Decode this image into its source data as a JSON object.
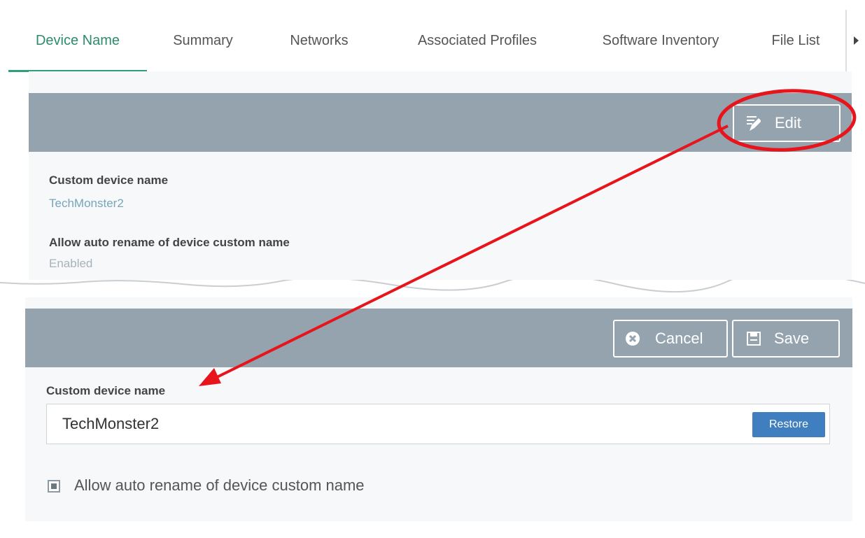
{
  "tabs": [
    {
      "label": "Device Name",
      "active": true
    },
    {
      "label": "Summary",
      "active": false
    },
    {
      "label": "Networks",
      "active": false
    },
    {
      "label": "Associated Profiles",
      "active": false
    },
    {
      "label": "Software Inventory",
      "active": false
    },
    {
      "label": "File List",
      "active": false
    }
  ],
  "view_panel": {
    "edit_label": "Edit",
    "fields": [
      {
        "title": "Custom device name",
        "value": "TechMonster2"
      },
      {
        "title": "Allow auto rename of device custom name",
        "value": "Enabled"
      }
    ]
  },
  "edit_panel": {
    "cancel_label": "Cancel",
    "save_label": "Save",
    "name_field_title": "Custom device name",
    "name_field_value": "TechMonster2",
    "restore_label": "Restore",
    "checkbox_label": "Allow auto rename of device custom name",
    "checkbox_checked": true
  },
  "colors": {
    "accent": "#2e9e7b",
    "header_bar": "#94a3ae",
    "restore_button": "#3f7fbf",
    "annotation": "#e8141c"
  },
  "icons": [
    "edit-icon",
    "cancel-icon",
    "save-icon",
    "chevron-right-icon"
  ]
}
